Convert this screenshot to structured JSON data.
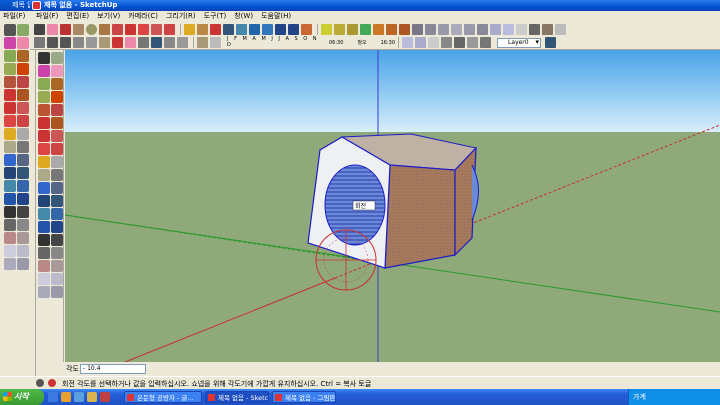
{
  "back_window": {
    "title": "제목 없음",
    "menu": "파일(F)"
  },
  "window": {
    "title": "제목 없음 - SketchUp"
  },
  "menu": [
    "파일(F)",
    "편집(E)",
    "보기(V)",
    "카메라(C)",
    "그리기(R)",
    "도구(T)",
    "창(W)",
    "도움말(H)"
  ],
  "shadow_slider": {
    "months": "J F M A M J J A S O N D",
    "start_time": "06:30",
    "mid_label": "정오",
    "end_time": "16:30"
  },
  "layer": {
    "selected": "Layer0"
  },
  "vcb": {
    "label": "각도",
    "value": "- 10.4"
  },
  "status": {
    "hint": "회전 각도를 선택하거나 값을 입력하십시오.  쇼넵을 위해 각도기에 가깝게 유지하십시오.  Ctrl = 복사 토글"
  },
  "taskbar": {
    "start": "시작",
    "tasks": [
      "은둔형 공방자 - 글...",
      "제목 없음 - Sketch...",
      "제목 없음 - 그림판"
    ],
    "tray": "가계",
    "colors": {
      "taskbar": "#245edb",
      "start": "#3a9a33"
    }
  },
  "viewport": {
    "cursor_label": "회전",
    "colors": {
      "sky": "#8fc7f0",
      "ground": "#8fa97a",
      "box_face": "#a77a5e",
      "edge": "#1c1cc8"
    }
  }
}
